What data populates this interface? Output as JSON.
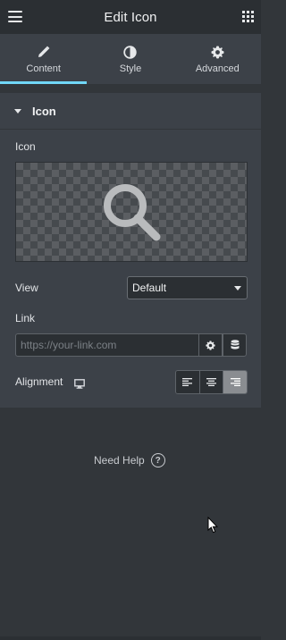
{
  "header": {
    "title": "Edit Icon"
  },
  "tabs": [
    {
      "label": "Content",
      "icon": "pencil-icon",
      "active": true
    },
    {
      "label": "Style",
      "icon": "half-circle-icon",
      "active": false
    },
    {
      "label": "Advanced",
      "icon": "gear-icon",
      "active": false
    }
  ],
  "section": {
    "title": "Icon"
  },
  "fields": {
    "icon_label": "Icon",
    "icon_preview": "search-icon",
    "view_label": "View",
    "view_value": "Default",
    "link_label": "Link",
    "link_placeholder": "https://your-link.com",
    "alignment_label": "Alignment",
    "alignment_selected": "right"
  },
  "footer": {
    "help_label": "Need Help",
    "help_glyph": "?"
  },
  "colors": {
    "accent": "#71d7f7",
    "panel_bg": "#3c4148",
    "page_bg": "#32363a"
  }
}
